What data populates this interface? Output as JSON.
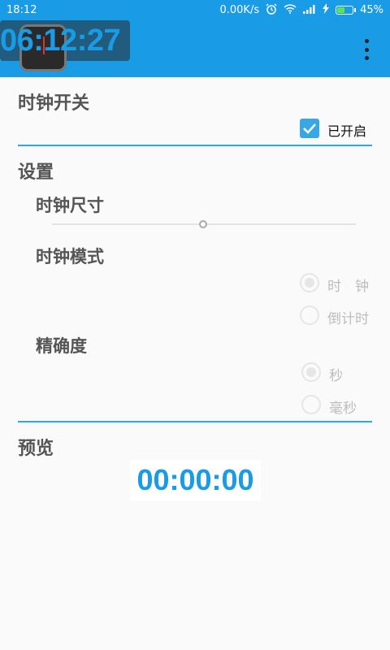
{
  "status_bar": {
    "time": "18:12",
    "net_speed": "0.00K/s",
    "battery": "45%",
    "icons": [
      "alarm-icon",
      "wifi-icon",
      "signal-icon",
      "charging-icon",
      "battery-icon"
    ]
  },
  "overlay": {
    "time": "06:12:27"
  },
  "app_bar": {
    "menu_icon": "more-vert-icon",
    "accent_color": "#1a9be6"
  },
  "clock_switch": {
    "title": "时钟开关",
    "checkbox_label": "已开启",
    "checked": true
  },
  "settings": {
    "title": "设置",
    "size": {
      "label": "时钟尺寸",
      "value": 0.5
    },
    "mode": {
      "label": "时钟模式",
      "options": [
        "时　钟",
        "倒计时"
      ],
      "selected": "时　钟"
    },
    "precision": {
      "label": "精确度",
      "options": [
        "秒",
        "毫秒"
      ],
      "selected": "秒"
    }
  },
  "preview": {
    "title": "预览",
    "time": "00:00:00"
  }
}
